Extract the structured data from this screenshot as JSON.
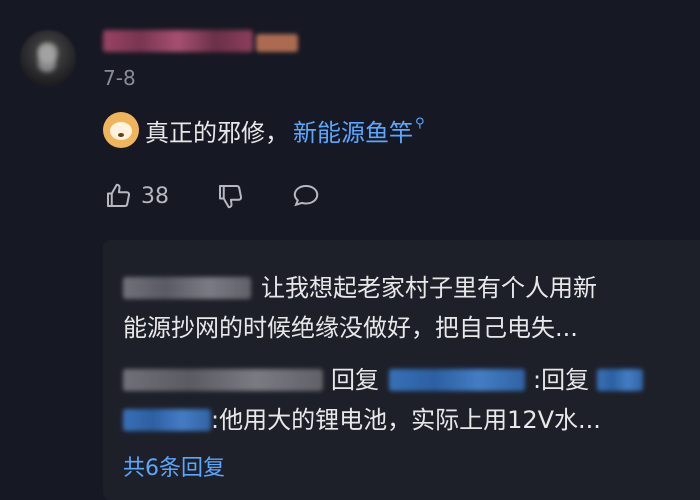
{
  "comment": {
    "date": "7-8",
    "text": "真正的邪修，",
    "link_text": "新能源鱼竿",
    "likes": "38"
  },
  "replies": [
    {
      "line1": "让我想起老家村子里有个人用新",
      "line2": "能源抄网的时候绝缘没做好，把自己电失..."
    },
    {
      "part_reply": "回复",
      "part_colon_reply": ":回复",
      "line2": ":他用大的锂电池，实际上用12V水..."
    }
  ],
  "more_replies_label": "共6条回复",
  "colors": {
    "background": "#161823",
    "reply_background": "#1e2029",
    "link": "#5aa7ff",
    "muted": "#8b8c93"
  },
  "icons": [
    "search-icon",
    "thumb-up-icon",
    "thumb-down-icon",
    "comment-bubble-icon",
    "emoji-dog-icon"
  ]
}
